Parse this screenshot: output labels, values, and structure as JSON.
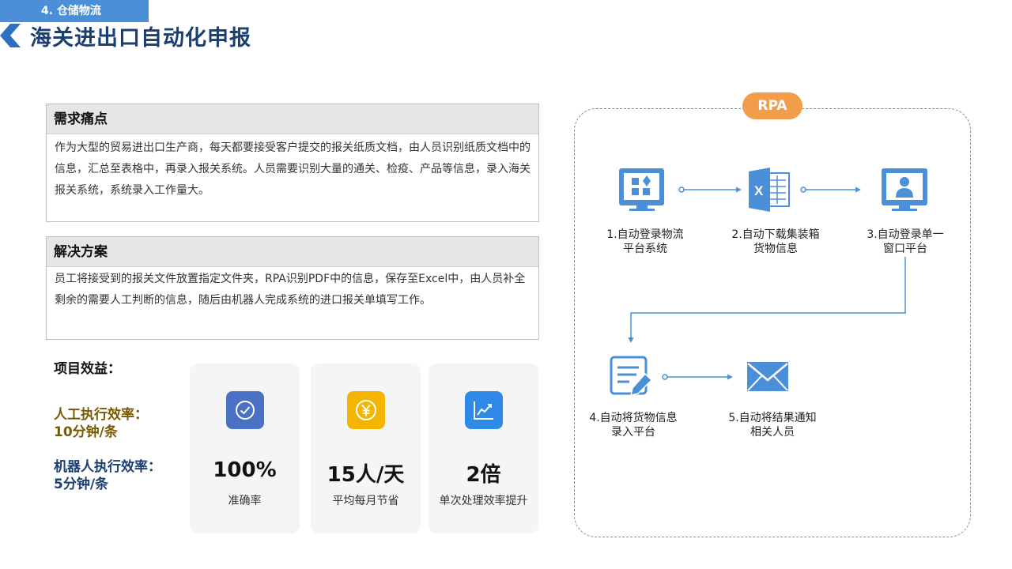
{
  "header": {
    "section_tag": "4. 仓储物流",
    "title": "海关进出口自动化申报"
  },
  "pain": {
    "heading": "需求痛点",
    "body": "作为大型的贸易进出口生产商，每天都要接受客户提交的报关纸质文档，由人员识别纸质文档中的信息，汇总至表格中，再录入报关系统。人员需要识别大量的通关、检疫、产品等信息，录入海关报关系统，系统录入工作量大。"
  },
  "solution": {
    "heading": "解决方案",
    "body": "员工将接受到的报关文件放置指定文件夹，RPA识别PDF中的信息，保存至Excel中，由人员补全剩余的需要人工判断的信息，随后由机器人完成系统的进口报关单填写工作。"
  },
  "benefits": {
    "label": "项目效益：",
    "manual_title": "人工执行效率：",
    "manual_value": "10分钟/条",
    "robot_title": "机器人执行效率：",
    "robot_value": "5分钟/条",
    "cards": [
      {
        "icon": "check-circle-icon",
        "color": "#4a72c4",
        "value": "100%",
        "desc": "准确率"
      },
      {
        "icon": "yen-coin-icon",
        "color": "#f5b400",
        "value": "15人/天",
        "desc": "平均每月节省"
      },
      {
        "icon": "trend-chart-icon",
        "color": "#2e8ae6",
        "value": "2倍",
        "desc": "单次处理效率提升"
      }
    ]
  },
  "flow": {
    "badge": "RPA",
    "accent": "#4a8fd8",
    "steps": [
      {
        "icon": "monitor-apps-icon",
        "line1": "1.自动登录物流",
        "line2": "平台系统"
      },
      {
        "icon": "excel-icon",
        "line1": "2.自动下载集装箱",
        "line2": "货物信息"
      },
      {
        "icon": "monitor-user-icon",
        "line1": "3.自动登录单一",
        "line2": "窗口平台"
      },
      {
        "icon": "edit-document-icon",
        "line1": "4.自动将货物信息",
        "line2": "录入平台"
      },
      {
        "icon": "mail-icon",
        "line1": "5.自动将结果通知",
        "line2": "相关人员"
      }
    ]
  }
}
